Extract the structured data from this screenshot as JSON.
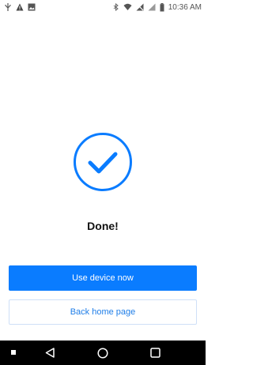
{
  "status_bar": {
    "time": "10:36 AM",
    "left_icons": [
      "usb-icon",
      "warning-icon",
      "image-icon"
    ],
    "right_icons": [
      "bluetooth-icon",
      "wifi-icon",
      "no-signal-icon",
      "signal-icon",
      "battery-icon"
    ]
  },
  "main": {
    "status_icon": "checkmark-circle-icon",
    "title": "Done!",
    "primary_button_label": "Use device now",
    "secondary_button_label": "Back home page"
  },
  "nav_bar": {
    "buttons": [
      "menu-dot-icon",
      "back-icon",
      "home-icon",
      "recents-icon"
    ]
  },
  "colors": {
    "accent": "#0a7cff",
    "secondary_text": "#1f7ee8",
    "secondary_border": "#cfe0f7"
  }
}
